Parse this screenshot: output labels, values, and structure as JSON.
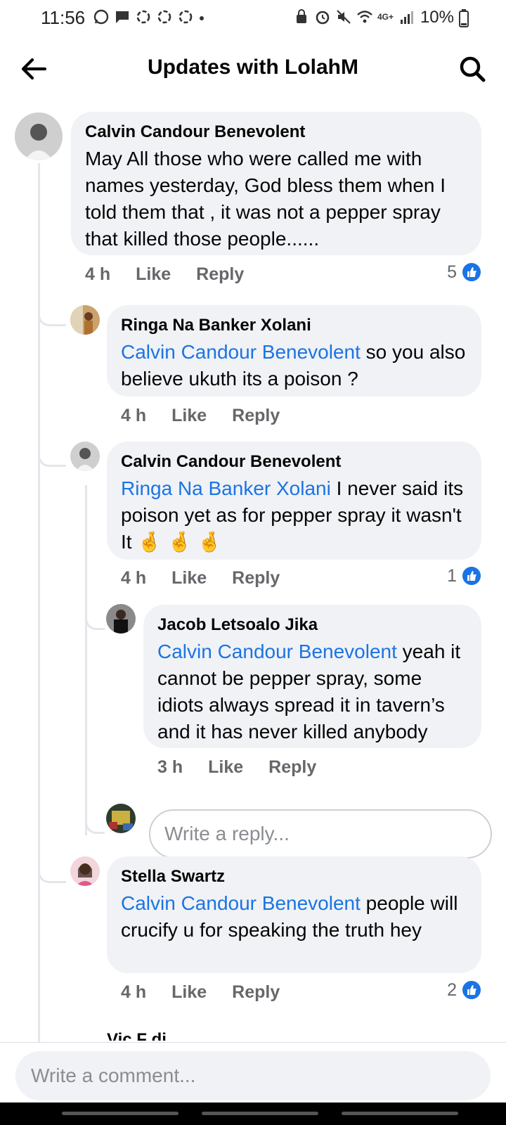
{
  "status_bar": {
    "time": "11:56",
    "network": "4G+",
    "battery": "10%"
  },
  "header": {
    "title": "Updates with LolahM"
  },
  "comments": [
    {
      "author": "Calvin Candour Benevolent",
      "mention": "",
      "text": "May All those who were called  me with names yesterday, God  bless them when I told them that , it was not a pepper spray that killed those people......",
      "time": "4 h",
      "like_label": "Like",
      "reply_label": "Reply",
      "reactions": "5"
    },
    {
      "author": "Ringa Na Banker Xolani",
      "mention": "Calvin Candour Benevolent",
      "text": " so you also believe ukuth its a poison ?",
      "time": "4 h",
      "like_label": "Like",
      "reply_label": "Reply",
      "reactions": ""
    },
    {
      "author": "Calvin Candour Benevolent",
      "mention": "Ringa Na Banker Xolani",
      "text": " I never said its poison yet as for pepper spray it wasn't It 🤞 🤞 🤞",
      "time": "4 h",
      "like_label": "Like",
      "reply_label": "Reply",
      "reactions": "1"
    },
    {
      "author": "Jacob Letsoalo Jika",
      "mention": "Calvin Candour Benevolent",
      "text": " yeah it cannot be pepper spray, some idiots always spread it in tavern’s and it has never killed anybody",
      "time": "3 h",
      "like_label": "Like",
      "reply_label": "Reply",
      "reactions": ""
    },
    {
      "author": "Stella Swartz",
      "mention": "Calvin Candour Benevolent",
      "text": " people will crucify u for speaking the truth hey",
      "time": "4 h",
      "like_label": "Like",
      "reply_label": "Reply",
      "reactions": "2"
    }
  ],
  "reply_box": {
    "placeholder": "Write a reply..."
  },
  "next_author_partial": "Vic   F    di",
  "footer": {
    "comment_placeholder": "Write a comment..."
  },
  "colors": {
    "mention": "#1b74e4",
    "bubble": "#f0f2f5",
    "meta_text": "#65676b",
    "like_badge": "#1b74e4"
  }
}
